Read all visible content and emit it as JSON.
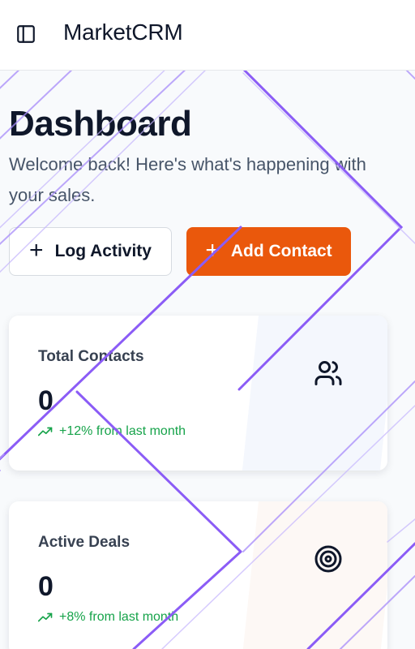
{
  "header": {
    "app_name": "MarketCRM",
    "toggle_icon": "panel-left-icon"
  },
  "page": {
    "title": "Dashboard",
    "subtitle": "Welcome back! Here's what's happening with your sales."
  },
  "actions": {
    "log_activity": "Log Activity",
    "add_contact": "Add Contact",
    "plus_glyph": "+"
  },
  "stats": [
    {
      "label": "Total Contacts",
      "value": "0",
      "trend": "+12% from last month",
      "icon": "users-icon"
    },
    {
      "label": "Active Deals",
      "value": "0",
      "trend": "+8% from last month",
      "icon": "target-icon"
    }
  ],
  "colors": {
    "primary_orange": "#ea580c",
    "trend_green": "#16a34a",
    "decor_purple": "#8b5cf6"
  }
}
